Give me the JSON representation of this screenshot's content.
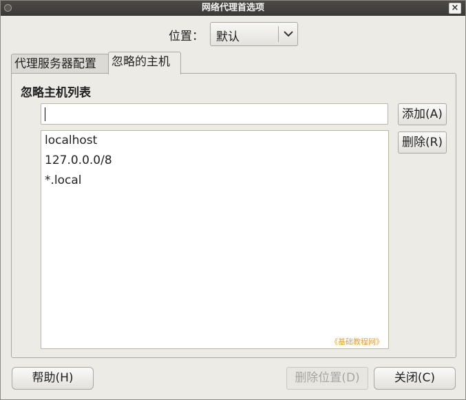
{
  "window": {
    "title": "网络代理首选项"
  },
  "location": {
    "label": "位置：",
    "value": "默认"
  },
  "tabs": [
    {
      "label": "代理服务器配置"
    },
    {
      "label": "忽略的主机"
    }
  ],
  "ignore_hosts": {
    "section_title": "忽略主机列表",
    "input_value": "",
    "add_label": "添加(A)",
    "remove_label": "删除(R)",
    "hosts": [
      "localhost",
      "127.0.0.0/8",
      "*.local"
    ]
  },
  "watermark": "《基础教程网》",
  "footer": {
    "help_label": "帮助(H)",
    "delete_location_label": "删除位置(D)",
    "close_label": "关闭(C)"
  },
  "icons": {
    "window_menu": "window-menu-icon",
    "close": "close-icon",
    "combo_arrow": "chevron-down-icon"
  }
}
